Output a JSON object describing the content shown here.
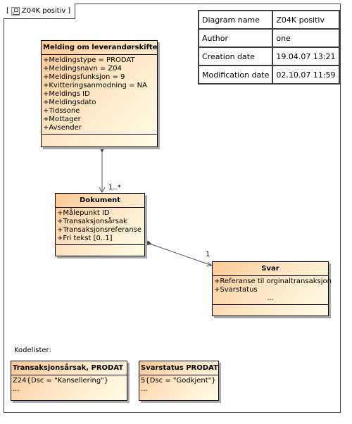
{
  "frame": {
    "title": "Z04K positiv",
    "icon": "class-diagram-icon"
  },
  "info_table": [
    {
      "key": "Diagram name",
      "value": "Z04K positiv"
    },
    {
      "key": "Author",
      "value": "one"
    },
    {
      "key": "Creation date",
      "value": "19.04.07 13:21"
    },
    {
      "key": "Modification date",
      "value": "02.10.07 11:59"
    }
  ],
  "classes": {
    "melding": {
      "name": "Melding om leverandørskifte",
      "attributes": [
        "+Meldingstype = PRODAT",
        "+Meldingsnavn = Z04",
        "+Meldingsfunksjon = 9",
        "+Kvitteringsanmodning = NA",
        "+Meldings ID",
        "+Meldingsdato",
        "+Tidssone",
        "+Mottager",
        "+Avsender"
      ]
    },
    "dokument": {
      "name": "Dokument",
      "attributes": [
        "+Målepunkt ID",
        "+Transaksjonsårsak",
        "+Transaksjonsreferanse",
        "+Fri tekst [0..1]"
      ]
    },
    "svar": {
      "name": "Svar",
      "attributes": [
        "+Referanse til orginaltransaksjon",
        "+Svarstatus"
      ],
      "more": "..."
    },
    "transaksjonsarsak": {
      "name": "Transaksjonsårsak, PRODAT",
      "literals": [
        "Z24{Dsc = \"Kansellering\"}",
        "..."
      ]
    },
    "svarstatus": {
      "name": "Svarstatus PRODAT",
      "literals": [
        "5{Dsc = \"Godkjent\"}",
        "..."
      ]
    }
  },
  "associations": {
    "melding_dokument": {
      "multiplicity": "1..*"
    },
    "dokument_svar": {
      "multiplicity": "1"
    }
  },
  "kodelister_label": "Kodelister:"
}
